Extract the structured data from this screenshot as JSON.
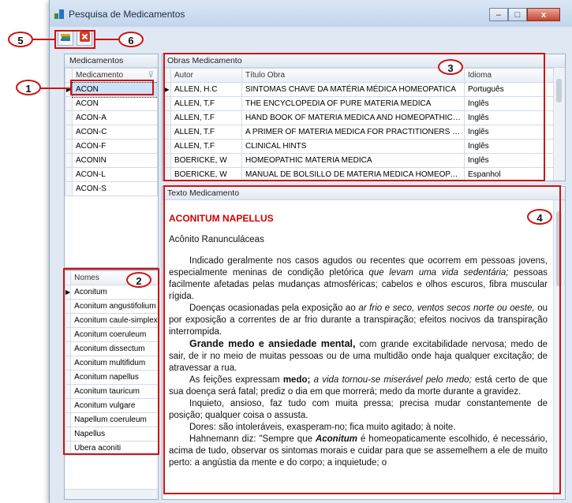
{
  "window": {
    "title": "Pesquisa de Medicamentos",
    "minimize": "–",
    "maximize": "□",
    "close": "x"
  },
  "callouts": {
    "c1": "1",
    "c2": "2",
    "c3": "3",
    "c4": "4",
    "c5": "5",
    "c6": "6"
  },
  "medicamentos": {
    "panel_title": "Medicamentos",
    "column": "Medicamento",
    "items": [
      "ACON",
      "ACON",
      "ACON-A",
      "ACON-C",
      "ACON-F",
      "ACONIN",
      "ACON-L",
      "ACON-S"
    ]
  },
  "nomes": {
    "column": "Nomes",
    "items": [
      "Aconitum",
      "Aconitum angustifolium",
      "Aconitum caule-simplex",
      "Aconitum coeruleum",
      "Aconitum dissectum",
      "Aconitum multifidum",
      "Aconitum napellus",
      "Aconitum tauricum",
      "Aconitum vulgare",
      "Napellum coeruleum",
      "Napellus",
      "Ubera aconiti"
    ]
  },
  "obras": {
    "panel_title": "Obras Medicamento",
    "columns": [
      "Autor",
      "Título Obra",
      "Idioma"
    ],
    "rows": [
      [
        "ALLEN, H.C",
        "SINTOMAS CHAVE DA MATÉRIA MÉDICA HOMEOPATICA",
        "Português"
      ],
      [
        "ALLEN, T.F",
        "THE ENCYCLOPEDIA OF PURE MATERIA MEDICA",
        "Inglês"
      ],
      [
        "ALLEN, T.F",
        "HAND BOOK OF MATERIA MEDICA AND HOMEOPATHIC THERAP...",
        "Inglês"
      ],
      [
        "ALLEN, T.F",
        "A PRIMER OF MATERIA MEDICA FOR PRACTITIONERS OF HOM...",
        "Inglês"
      ],
      [
        "ALLEN, T.F",
        "CLINICAL HINTS",
        "Inglês"
      ],
      [
        "BOERICKE, W",
        "HOMEOPATHIC MATERIA MEDICA",
        "Inglês"
      ],
      [
        "BOERICKE, W",
        "MANUAL DE BOLSILLO DE MATERIA MEDICA HOMEOPATICA",
        "Espanhol"
      ]
    ]
  },
  "texto": {
    "panel_title": "Texto Medicamento",
    "heading": "ACONITUM NAPELLUS",
    "subtitle": "Acônito Ranunculáceas",
    "p1a": "Indicado geralmente nos casos agudos ou recentes que ocorrem em pessoas jovens, especialmente meninas de condição pletórica ",
    "p1b": "que levam uma vida sedentária;",
    "p1c": " pessoas facilmente afetadas pelas mudanças atmosféricas; cabelos e olhos escuros, fibra muscular rígida.",
    "p2a": "Doenças ocasionadas pela exposição ao ",
    "p2b": "ar frio e seco, ventos secos norte ou oeste,",
    "p2c": " ou por exposição a correntes de ar frio durante a transpiração; efeitos nocivos da transpiração interrompida.",
    "p3a": "Grande medo e ansiedade mental,",
    "p3b": " com grande excitabilidade nervosa; medo de sair, de ir no meio de muitas pessoas ou de uma multidão onde haja qualquer excitação; de atravessar a rua.",
    "p4a": "As feições expressam ",
    "p4b": "medo;",
    "p4c": " a vida tornou-se miserável pelo medo;",
    "p4d": " está certo de que sua doença será fatal; prediz o dia em que morrerá; medo da morte durante a gravidez.",
    "p5": "Inquieto, ansioso, faz tudo com muita pressa; precisa mudar constantemente de posição; qualquer coisa o assusta.",
    "p6": "Dores: são intoleráveis, exasperam-no; fica muito agitado; à noite.",
    "p7a": "Hahnemann diz: \"Sempre que ",
    "p7b": "Aconitum",
    "p7c": " é homeopaticamente escolhido, é necessário, acima de tudo, observar os sintomas morais e cuidar para que se assemelhem a ele de muito perto: a angústia da mente e do corpo; a inquietude; o"
  }
}
